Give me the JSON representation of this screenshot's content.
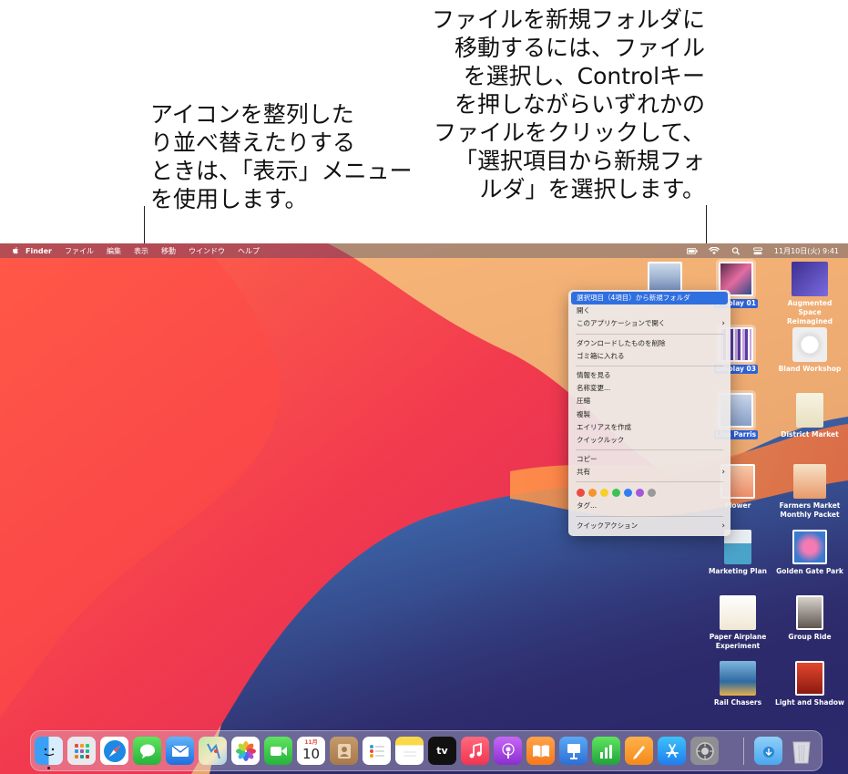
{
  "callouts": {
    "left": "アイコンを整列した\nり並べ替えたりする\nときは、「表示」メニュー\nを使用します。",
    "right": "ファイルを新規フォルダに\n移動するには、ファイル\nを選択し、Controlキー\nを押しながらいずれかの\nファイルをクリックして、\n「選択項目から新規フォ\nルダ」を選択します。"
  },
  "menubar": {
    "app_name": "Finder",
    "items": [
      "ファイル",
      "編集",
      "表示",
      "移動",
      "ウインドウ",
      "ヘルプ"
    ],
    "datetime": "11月10日(火)  9:41",
    "status_icons": [
      "battery-icon",
      "wifi-icon",
      "spotlight-icon",
      "control-center-icon"
    ]
  },
  "context_menu": {
    "highlighted": "選択項目（4項目）から新規フォルダ",
    "group1": [
      "開く",
      "このアプリケーションで開く"
    ],
    "group2": [
      "ダウンロードしたものを削除",
      "ゴミ箱に入れる"
    ],
    "group3": [
      "情報を見る",
      "名称変更...",
      "圧縮",
      "複製",
      "エイリアスを作成",
      "クイックルック"
    ],
    "group4": [
      "コピー",
      "共有"
    ],
    "tag_colors": [
      "#ee4a3f",
      "#f5942e",
      "#f6cf2d",
      "#3cc153",
      "#2f7df6",
      "#a457d9",
      "#9a9a9a"
    ],
    "tags_label": "タグ...",
    "quick_actions": "クイックアクション"
  },
  "desktop_icons": {
    "display01": "Display 01",
    "augmented": "Augmented Space Reimagined",
    "display03": "Display 03",
    "bland": "Bland Workshop",
    "lisa": "Lisa Parris",
    "district": "District Market",
    "flower": "Flower",
    "farmers": "Farmers Market Monthly Packet",
    "marketing": "Marketing Plan",
    "golden": "Golden Gate Park",
    "paper": "Paper Airplane Experiment",
    "group": "Group Ride",
    "rail": "Rail Chasers",
    "light": "Light and Shadow"
  },
  "dock": {
    "calendar_month": "11月",
    "calendar_day": "10",
    "tv_label": "tv",
    "apps": [
      "finder-icon",
      "launchpad-icon",
      "safari-icon",
      "messages-icon",
      "mail-icon",
      "maps-icon",
      "photos-icon",
      "facetime-icon",
      "calendar-icon",
      "contacts-icon",
      "reminders-icon",
      "notes-icon",
      "tv-icon",
      "music-icon",
      "podcasts-icon",
      "books-icon",
      "keynote-icon",
      "numbers-icon",
      "pages-icon",
      "app-store-icon",
      "system-preferences-icon",
      "downloads-folder-icon",
      "trash-icon"
    ]
  }
}
